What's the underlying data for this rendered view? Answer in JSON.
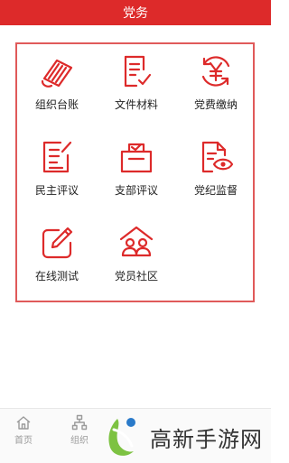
{
  "header": {
    "title": "党务"
  },
  "theme": {
    "accent": "#dd2a2a",
    "frame": "#e05a5a",
    "text": "#222222"
  },
  "grid": {
    "items": [
      {
        "label": "组织台账",
        "icon": "ledger-icon"
      },
      {
        "label": "文件材料",
        "icon": "document-check-icon"
      },
      {
        "label": "党费缴纳",
        "icon": "yuan-refresh-icon"
      },
      {
        "label": "民主评议",
        "icon": "edit-note-icon"
      },
      {
        "label": "支部评议",
        "icon": "ballot-box-icon"
      },
      {
        "label": "党纪监督",
        "icon": "document-eye-icon"
      },
      {
        "label": "在线测试",
        "icon": "pencil-square-icon"
      },
      {
        "label": "党员社区",
        "icon": "community-people-icon"
      }
    ]
  },
  "tabbar": {
    "home_label": "首页",
    "org_label": "组织"
  },
  "watermark": {
    "text": "高新手游网"
  }
}
